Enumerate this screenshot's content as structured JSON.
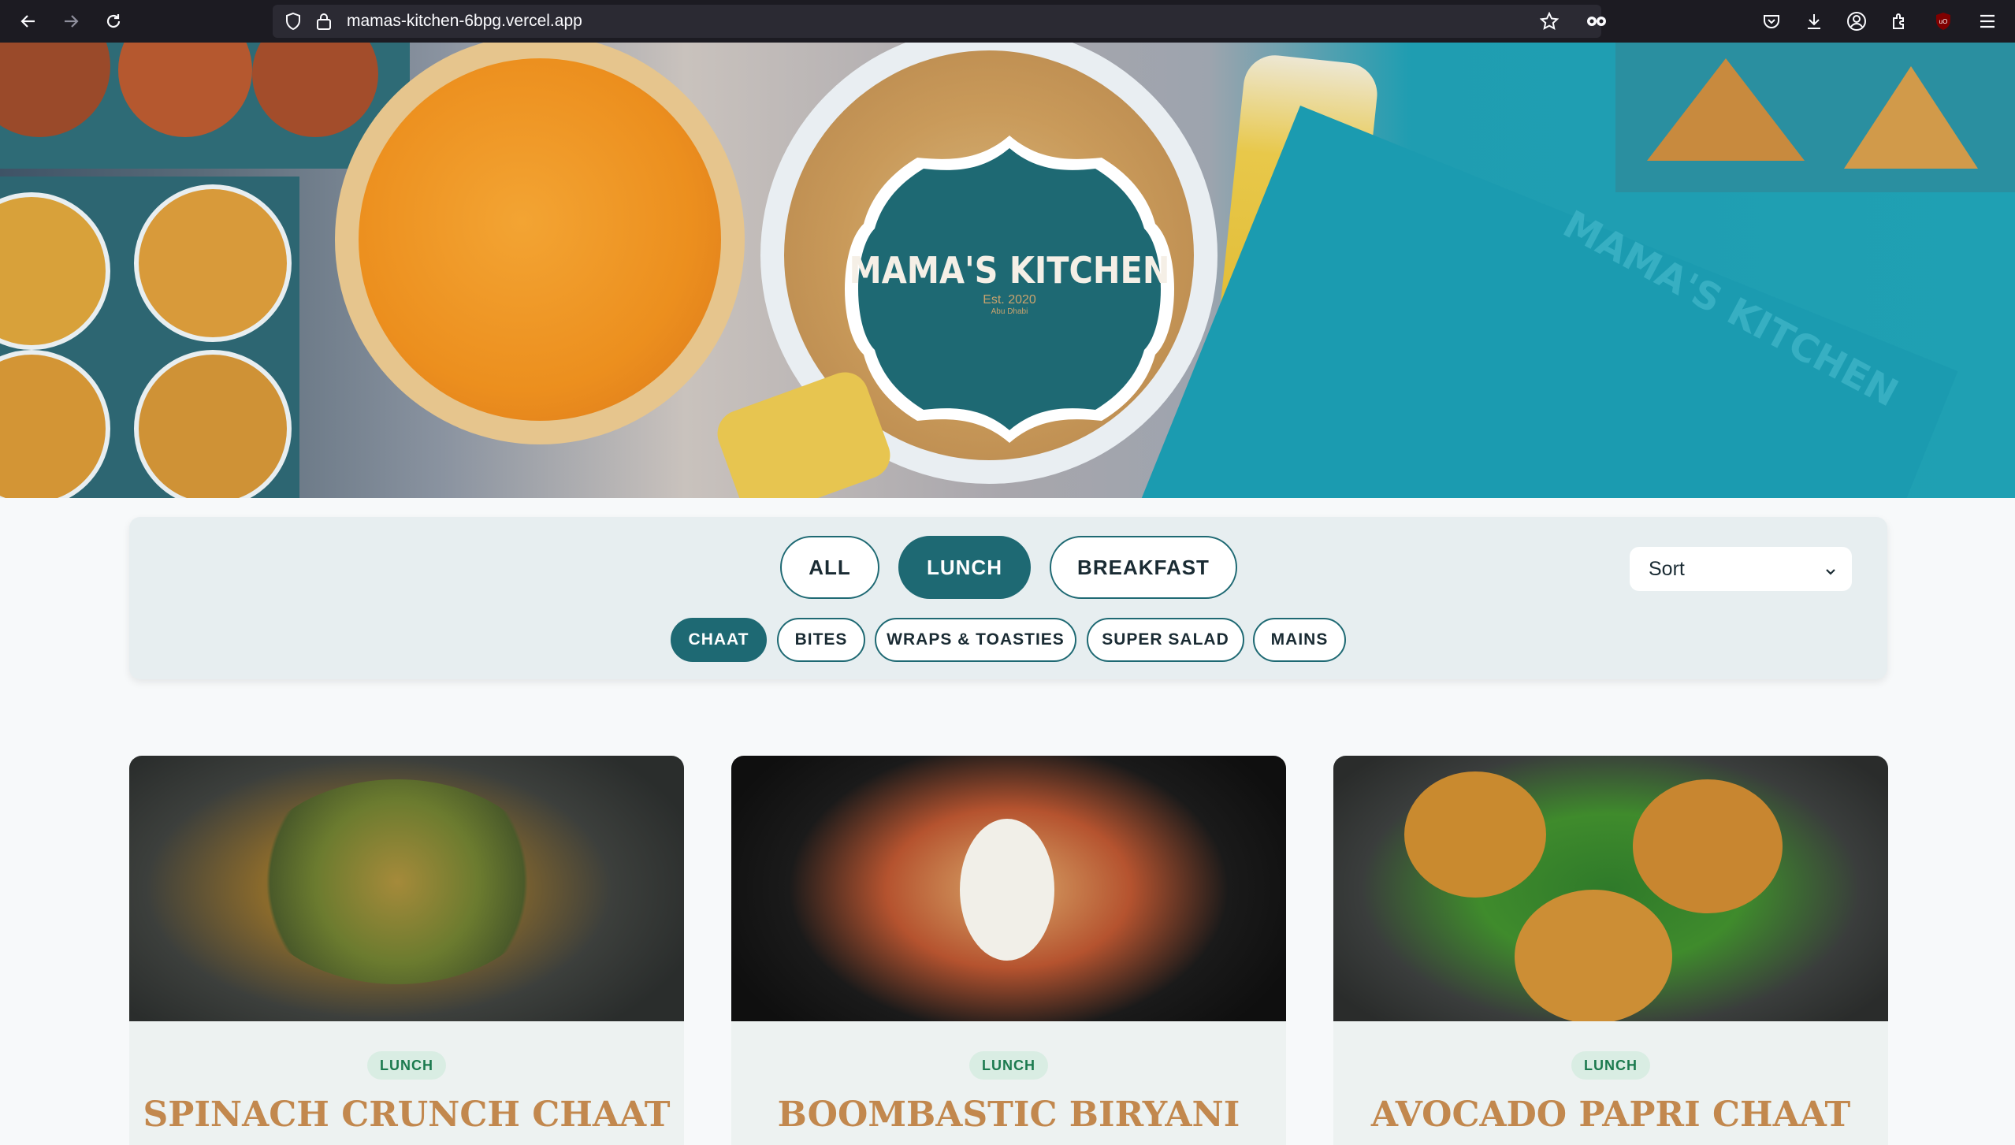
{
  "browser": {
    "url": "mamas-kitchen-6bpg.vercel.app",
    "icons": [
      "back-icon",
      "forward-icon",
      "reload-icon",
      "shield-icon",
      "lock-icon",
      "star-icon",
      "mask-icon",
      "pocket-icon",
      "download-icon",
      "account-icon",
      "extensions-icon",
      "ublock-icon",
      "menu-icon"
    ]
  },
  "hero": {
    "logo_title": "MAMA'S KITCHEN",
    "logo_est": "Est. 2020",
    "logo_city": "Abu Dhabi",
    "box_text": "MAMA'S KITCHEN"
  },
  "filters": {
    "categories": [
      {
        "label": "ALL",
        "active": false
      },
      {
        "label": "LUNCH",
        "active": true
      },
      {
        "label": "BREAKFAST",
        "active": false
      }
    ],
    "subcategories": [
      {
        "label": "CHAAT",
        "active": true
      },
      {
        "label": "BITES",
        "active": false
      },
      {
        "label": "WRAPS & TOASTIES",
        "active": false
      },
      {
        "label": "SUPER SALAD",
        "active": false
      },
      {
        "label": "MAINS",
        "active": false
      }
    ],
    "sort_label": "Sort"
  },
  "cards": [
    {
      "badge": "LUNCH",
      "title": "SPINACH CRUNCH CHAAT"
    },
    {
      "badge": "LUNCH",
      "title": "BOOMBASTIC BIRYANI"
    },
    {
      "badge": "LUNCH",
      "title": "AVOCADO PAPRI CHAAT"
    }
  ],
  "colors": {
    "brand_teal": "#1e6973",
    "title_gold": "#c2884e",
    "badge_green": "#1b7a4e",
    "toolbar_bg": "#1c1b22"
  }
}
